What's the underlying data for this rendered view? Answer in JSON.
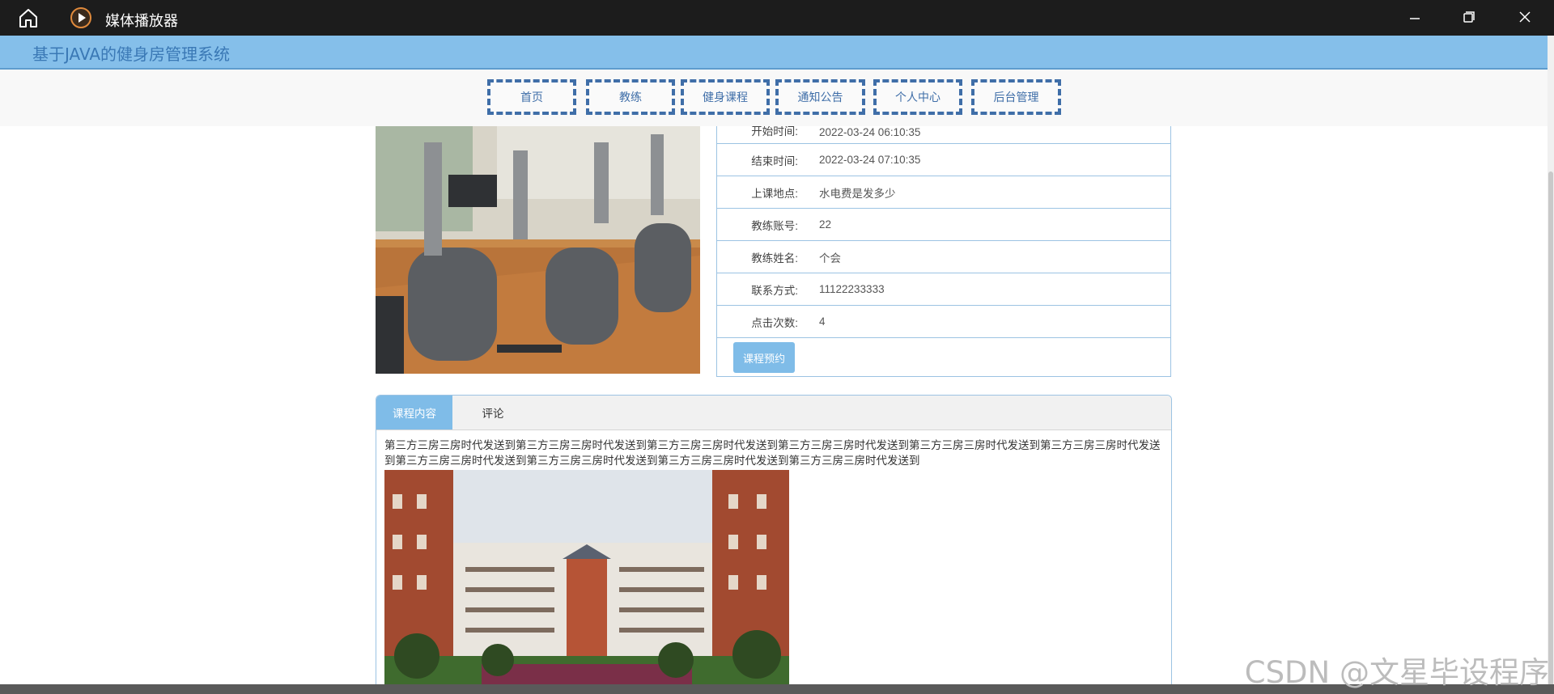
{
  "window": {
    "title": "媒体播放器"
  },
  "site": {
    "title": "基于JAVA的健身房管理系统"
  },
  "nav": {
    "items": [
      {
        "label": "首页"
      },
      {
        "label": "教练"
      },
      {
        "label": "健身课程"
      },
      {
        "label": "通知公告"
      },
      {
        "label": "个人中心"
      },
      {
        "label": "后台管理"
      }
    ]
  },
  "course": {
    "fields": [
      {
        "label": "开始时间:",
        "value": "2022-03-24 06:10:35"
      },
      {
        "label": "结束时间:",
        "value": "2022-03-24 07:10:35"
      },
      {
        "label": "上课地点:",
        "value": "水电费是发多少"
      },
      {
        "label": "教练账号:",
        "value": "22"
      },
      {
        "label": "教练姓名:",
        "value": "个会"
      },
      {
        "label": "联系方式:",
        "value": "11122233333"
      },
      {
        "label": "点击次数:",
        "value": "4"
      }
    ],
    "book_button": "课程预约"
  },
  "tabs": {
    "items": [
      {
        "label": "课程内容",
        "active": true
      },
      {
        "label": "评论",
        "active": false
      }
    ],
    "content_text": "第三方三房三房时代发送到第三方三房三房时代发送到第三方三房三房时代发送到第三方三房三房时代发送到第三方三房三房时代发送到第三方三房三房时代发送到第三方三房三房时代发送到第三方三房三房时代发送到第三方三房三房时代发送到第三方三房三房时代发送到"
  },
  "watermark": "CSDN @文星毕设程序",
  "colors": {
    "header_blue": "#85bfea",
    "nav_border": "#3f6ea8",
    "accent": "#7fbce8",
    "titlebar": "#1c1c1c"
  }
}
